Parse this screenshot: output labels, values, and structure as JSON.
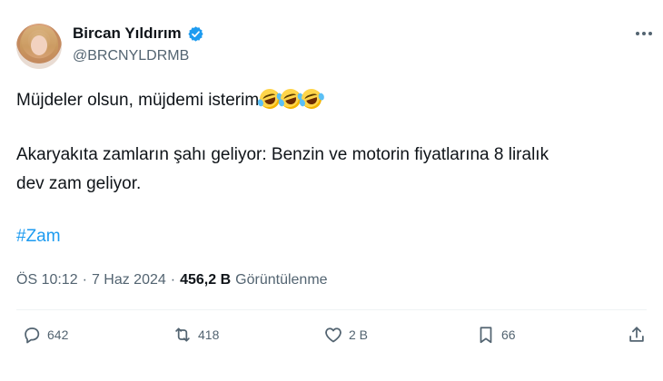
{
  "author": {
    "display_name": "Bircan Yıldırım",
    "handle": "@BRCNYLDRMB",
    "verified": true
  },
  "icons": {
    "verified": "verified-badge-icon",
    "more": "more-options-icon",
    "emoji": "rolling-on-floor-laughing-emoji",
    "reply": "reply-icon",
    "repost": "repost-icon",
    "like": "heart-icon",
    "bookmark": "bookmark-icon",
    "share": "share-icon"
  },
  "colors": {
    "text": "#0f1419",
    "secondary": "#536471",
    "link": "#1d9bf0",
    "verified": "#1d9bf0"
  },
  "tweet": {
    "line1": "Müjdeler olsun, müjdemi isterim",
    "emoji_count": 3,
    "line2": "Akaryakıta zamların şahı geliyor: Benzin ve motorin fiyatlarına 8 liralık",
    "line3": "dev zam geliyor.",
    "hashtag": "#Zam"
  },
  "meta": {
    "time": "ÖS 10:12",
    "separator": "·",
    "date": "7 Haz 2024",
    "views_count": "456,2 B",
    "views_label": "Görüntülenme"
  },
  "actions": {
    "replies": "642",
    "reposts": "418",
    "likes": "2 B",
    "bookmarks": "66"
  }
}
